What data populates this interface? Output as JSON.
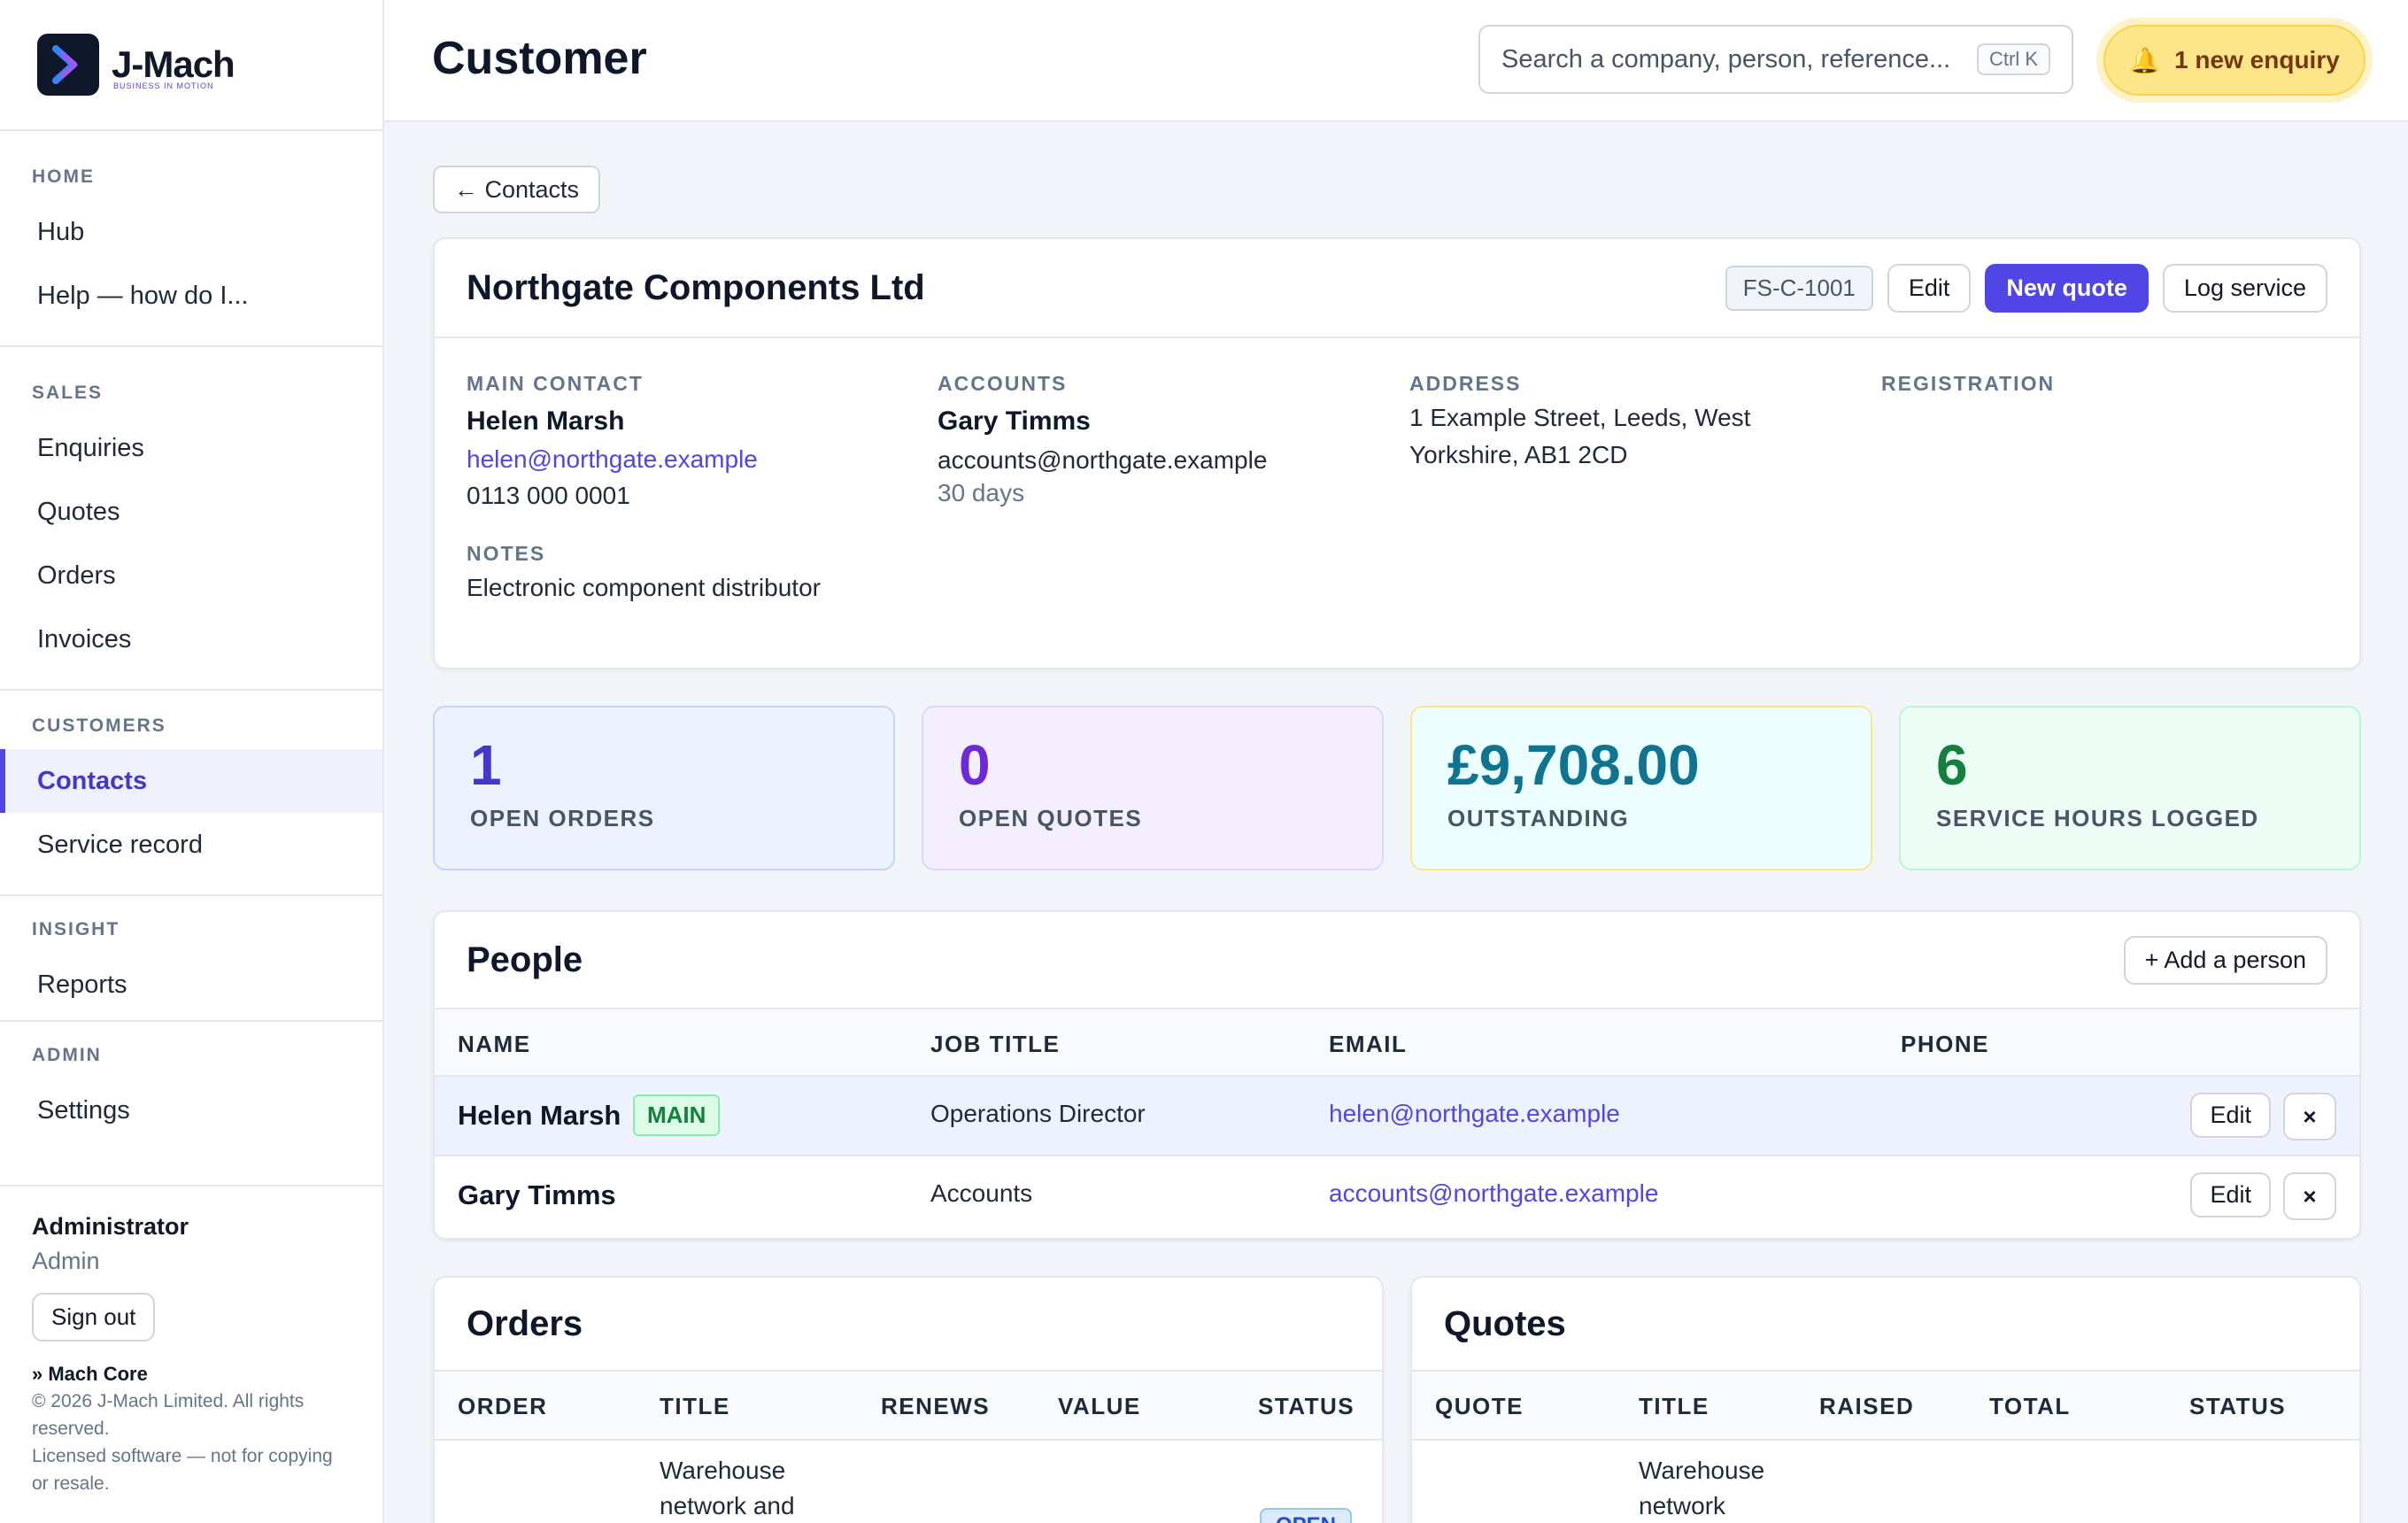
{
  "brand": {
    "name": "J-Mach",
    "tagline": "BUSINESS IN MOTION"
  },
  "nav": {
    "sections": [
      {
        "title": "HOME",
        "items": [
          "Hub",
          "Help — how do I..."
        ]
      },
      {
        "title": "SALES",
        "items": [
          "Enquiries",
          "Quotes",
          "Orders",
          "Invoices"
        ]
      },
      {
        "title": "CUSTOMERS",
        "items": [
          "Contacts",
          "Service record"
        ]
      },
      {
        "title": "INSIGHT",
        "items": [
          "Reports"
        ]
      },
      {
        "title": "ADMIN",
        "items": [
          "Settings"
        ]
      }
    ],
    "active": "Contacts"
  },
  "user": {
    "name": "Administrator",
    "role": "Admin",
    "signout_label": "Sign out"
  },
  "footer": {
    "product": "» Mach Core",
    "copyright": "© 2026 J-Mach Limited. All rights reserved.",
    "license": "Licensed software — not for copying or resale."
  },
  "header": {
    "title": "Customer",
    "search_placeholder": "Search a company, person, reference...",
    "search_shortcut": "Ctrl K",
    "enquiry_label": "1 new enquiry"
  },
  "back_label": "← Contacts",
  "company": {
    "name": "Northgate Components Ltd",
    "reference": "FS-C-1001",
    "edit_label": "Edit",
    "new_quote_label": "New quote",
    "log_service_label": "Log service",
    "main_contact": {
      "label": "MAIN CONTACT",
      "name": "Helen Marsh",
      "email": "helen@northgate.example",
      "phone": "0113 000 0001"
    },
    "accounts": {
      "label": "ACCOUNTS",
      "name": "Gary Timms",
      "email": "accounts@northgate.example",
      "terms": "30 days"
    },
    "address": {
      "label": "ADDRESS",
      "line1": "1 Example Street, Leeds, West",
      "line2": "Yorkshire, AB1 2CD"
    },
    "registration": {
      "label": "REGISTRATION"
    },
    "notes": {
      "label": "NOTES",
      "text": "Electronic component distributor"
    }
  },
  "stats": [
    {
      "value": "1",
      "label": "OPEN ORDERS"
    },
    {
      "value": "0",
      "label": "OPEN QUOTES"
    },
    {
      "value": "£9,708.00",
      "label": "OUTSTANDING"
    },
    {
      "value": "6",
      "label": "SERVICE HOURS LOGGED"
    }
  ],
  "people": {
    "title": "People",
    "add_label": "+ Add a person",
    "columns": [
      "NAME",
      "JOB TITLE",
      "EMAIL",
      "PHONE"
    ],
    "main_badge": "MAIN",
    "edit_label": "Edit",
    "remove_label": "×",
    "rows": [
      {
        "name": "Helen Marsh",
        "job_title": "Operations Director",
        "email": "helen@northgate.example",
        "phone": ""
      },
      {
        "name": "Gary Timms",
        "job_title": "Accounts",
        "email": "accounts@northgate.example",
        "phone": ""
      }
    ]
  },
  "orders": {
    "title": "Orders",
    "columns": [
      "ORDER",
      "TITLE",
      "RENEWS",
      "VALUE",
      "STATUS"
    ],
    "first_row": {
      "title_line1": "Warehouse",
      "title_line2": "network and",
      "status": "OPEN"
    }
  },
  "quotes": {
    "title": "Quotes",
    "columns": [
      "QUOTE",
      "TITLE",
      "RAISED",
      "TOTAL",
      "STATUS"
    ],
    "first_row": {
      "title_line1": "Warehouse",
      "title_line2": "network"
    }
  },
  "colors": {
    "accent": "#4f46e5",
    "enquiry_bg": "#fde68a",
    "main_badge": "#15803d"
  }
}
